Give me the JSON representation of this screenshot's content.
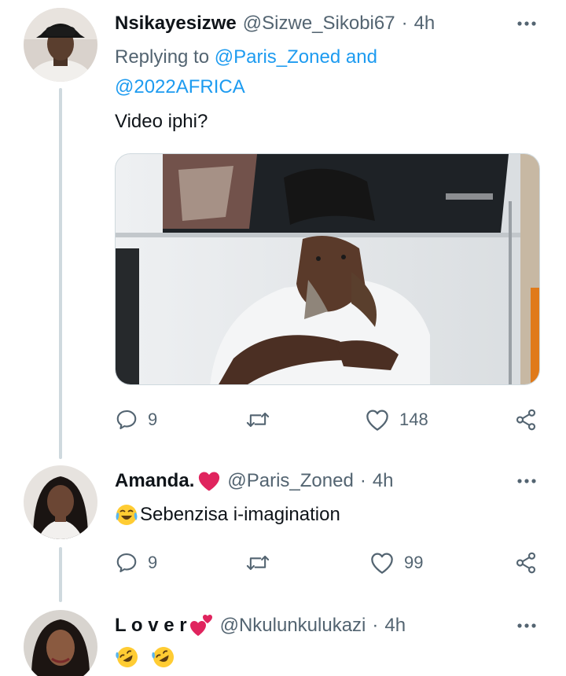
{
  "tweets": [
    {
      "name": "Nsikayesizwe",
      "handle": "@Sizwe_Sikobi67",
      "separator": "·",
      "time": "4h",
      "replying_prefix": "Replying to",
      "replying_mention1": "@Paris_Zoned",
      "replying_and": "and",
      "replying_mention2": "@2022AFRICA",
      "text": "Video iphi?",
      "has_media": true,
      "actions": {
        "replies": "9",
        "retweets": "",
        "likes": "148"
      }
    },
    {
      "name": "Amanda.",
      "name_emoji": "red-heart",
      "handle": "@Paris_Zoned",
      "separator": "·",
      "time": "4h",
      "text": "Sebenzisa i-imagination",
      "text_emoji": "crying-laughing-face",
      "actions": {
        "replies": "9",
        "retweets": "",
        "likes": "99"
      }
    },
    {
      "name": "L o v e r",
      "name_emoji": "two-hearts",
      "handle": "@Nkulunkulukazi",
      "separator": "·",
      "time": "4h",
      "text_emojis": [
        "rolling-on-floor-laughing",
        "rolling-on-floor-laughing"
      ]
    }
  ],
  "colors": {
    "accent": "#1d9bf0",
    "secondary_text": "#536471",
    "primary_text": "#0f1419",
    "thread_line": "#cfd9de",
    "heart_red": "#e0245e"
  }
}
